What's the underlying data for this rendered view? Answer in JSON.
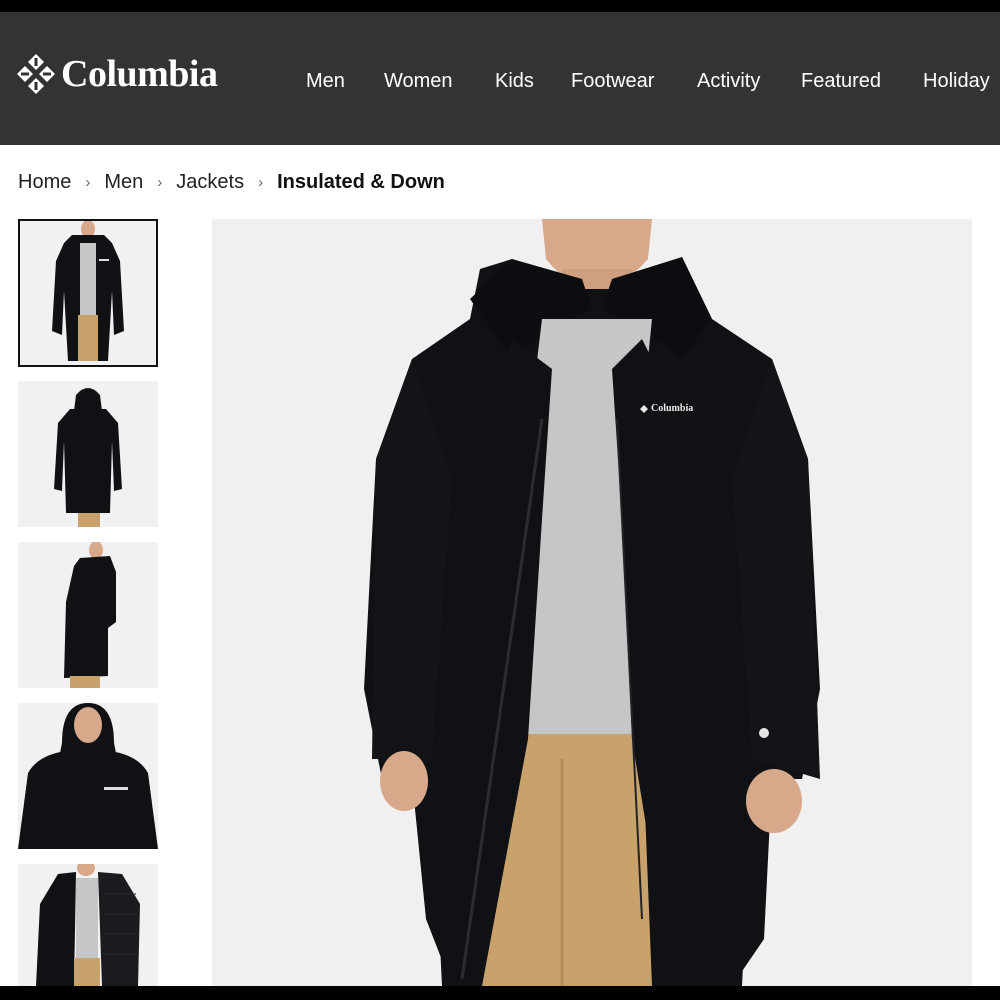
{
  "brand": {
    "name": "Columbia"
  },
  "nav": {
    "items": [
      "Men",
      "Women",
      "Kids",
      "Footwear",
      "Activity",
      "Featured",
      "Holiday"
    ]
  },
  "breadcrumb": {
    "items": [
      "Home",
      "Men",
      "Jackets"
    ],
    "current": "Insulated & Down",
    "separator": "›"
  },
  "product": {
    "chest_logo": "Columbia",
    "gallery": {
      "selected_index": 0,
      "thumbnails": [
        "front-open-view",
        "back-hood-up-view",
        "side-view",
        "hood-up-closeup",
        "inside-lining-view"
      ]
    }
  },
  "colors": {
    "header_bg": "#333333",
    "jacket": "#101114",
    "shirt": "#c4c6c8",
    "pants": "#c9a26b",
    "image_bg": "#f0f0f1"
  }
}
